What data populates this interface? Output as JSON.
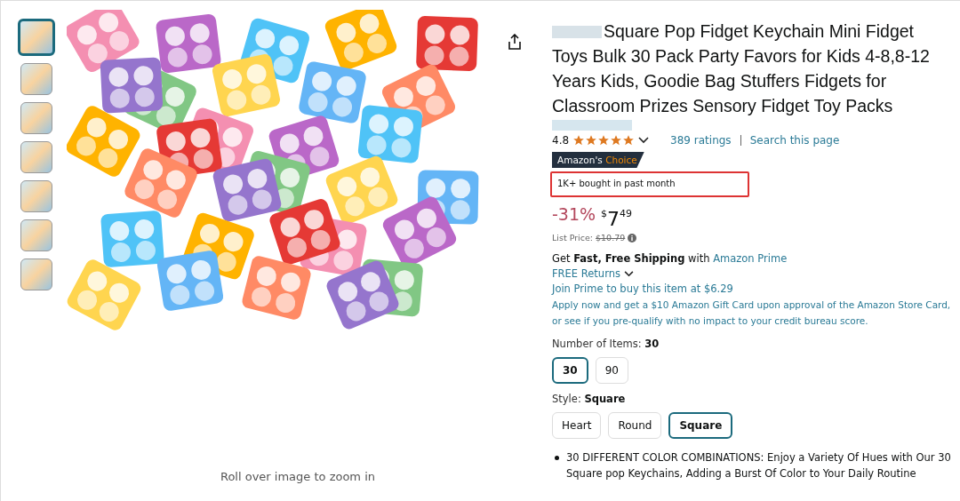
{
  "gallery": {
    "thumbnails": [
      {
        "selected": true
      },
      {
        "selected": false
      },
      {
        "selected": false
      },
      {
        "selected": false
      },
      {
        "selected": false
      },
      {
        "selected": false
      },
      {
        "selected": false
      }
    ],
    "zoom_hint": "Roll over image to zoom in"
  },
  "product": {
    "title": "Square Pop Fidget Keychain Mini Fidget Toys Bulk 30 Pack Party Favors for Kids 4-8,8-12 Years Kids, Goodie Bag Stuffers Fidgets for Classroom Prizes Sensory Fidget Toy Packs",
    "rating": "4.8",
    "stars": 5,
    "ratings_link": "389 ratings",
    "search_link": "Search this page",
    "badge": {
      "brand": "Amazon's",
      "word": "Choice"
    },
    "bought": {
      "text": "1K+ bought in past month",
      "highlighted": true
    },
    "price": {
      "discount": "-31%",
      "symbol": "$",
      "whole": "7",
      "fraction": "49"
    },
    "list_price": {
      "label": "List Price:",
      "value": "$10.79"
    },
    "shipping": {
      "text": "Get **Fast, Free Shipping** with",
      "link": "Amazon Prime"
    },
    "returns": "FREE Returns",
    "prime_offer": "Join Prime to buy this item at $6.29",
    "card_offer": "Apply now and get a $10 Amazon Gift Card upon approval of the Amazon Store Card, or see if you pre-qualify with no impact to your credit bureau score.",
    "variations": [
      {
        "label": "Number of Items:",
        "value": "30",
        "options": [
          {
            "label": "30",
            "selected": true
          },
          {
            "label": "90",
            "selected": false
          }
        ]
      },
      {
        "label": "Style:",
        "value": "Square",
        "options": [
          {
            "label": "Heart",
            "selected": false
          },
          {
            "label": "Round",
            "selected": false
          },
          {
            "label": "Square",
            "selected": true
          }
        ]
      }
    ],
    "bullets": [
      "30 DIFFERENT COLOR COMBINATIONS: Enjoy a Variety Of Hues with Our 30 Square pop Keychains, Adding a Burst Of Color to Your Daily Routine"
    ]
  }
}
